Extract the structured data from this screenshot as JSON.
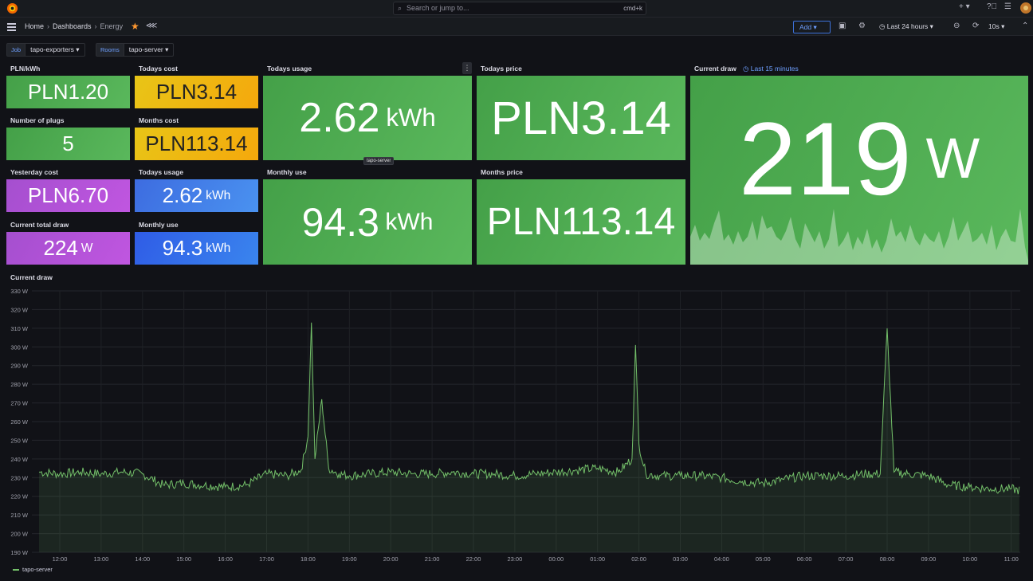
{
  "topbar": {
    "search_placeholder": "Search or jump to...",
    "search_shortcut": "cmd+k"
  },
  "breadcrumb": {
    "home": "Home",
    "dashboards": "Dashboards",
    "current": "Energy"
  },
  "toolbar": {
    "add_label": "Add",
    "time_range": "Last 24 hours",
    "refresh_interval": "10s"
  },
  "variables": [
    {
      "label": "Job",
      "value": "tapo-exporters"
    },
    {
      "label": "Rooms",
      "value": "tapo-server"
    }
  ],
  "panels": {
    "pln_kwh": {
      "title": "PLN/kWh",
      "value": "PLN1.20",
      "color": "#4ca64e"
    },
    "todays_cost": {
      "title": "Todays cost",
      "value": "PLN3.14",
      "color": "#f0b912"
    },
    "todays_usage_big": {
      "title": "Todays usage",
      "value": "2.62",
      "unit": "kWh",
      "color": "#4ca64e"
    },
    "todays_price": {
      "title": "Todays price",
      "value": "PLN3.14",
      "color": "#4ca64e"
    },
    "current_draw": {
      "title": "Current draw",
      "time_override": "Last 15 minutes",
      "value": "219",
      "unit": "W",
      "color": "#4ca64e"
    },
    "number_of_plugs": {
      "title": "Number of plugs",
      "value": "5",
      "color": "#4ca64e"
    },
    "months_cost": {
      "title": "Months cost",
      "value": "PLN113.14",
      "color": "#f0b912"
    },
    "yesterday_cost": {
      "title": "Yesterday cost",
      "value": "PLN6.70",
      "color": "#b052d8"
    },
    "todays_usage": {
      "title": "Todays usage",
      "value": "2.62",
      "unit": "kWh",
      "color": "#4282ea"
    },
    "monthly_use_big": {
      "title": "Monthly use",
      "value": "94.3",
      "unit": "kWh",
      "color": "#4ca64e"
    },
    "months_price": {
      "title": "Months price",
      "value": "PLN113.14",
      "color": "#4ca64e"
    },
    "current_total_draw": {
      "title": "Current total draw",
      "value": "224",
      "unit": "W",
      "color": "#b052d8"
    },
    "monthly_use": {
      "title": "Monthly use",
      "value": "94.3",
      "unit": "kWh",
      "color": "#3570e8"
    }
  },
  "tooltip_text": "tapo-server",
  "graph": {
    "title": "Current draw",
    "legend": "tapo-server"
  },
  "chart_data": {
    "type": "line",
    "title": "Current draw",
    "y_ticks": [
      "330 W",
      "320 W",
      "310 W",
      "300 W",
      "290 W",
      "280 W",
      "270 W",
      "260 W",
      "250 W",
      "240 W",
      "230 W",
      "220 W",
      "210 W",
      "200 W",
      "190 W"
    ],
    "ylim": [
      190,
      330
    ],
    "x_ticks": [
      "12:00",
      "13:00",
      "14:00",
      "15:00",
      "16:00",
      "17:00",
      "18:00",
      "19:00",
      "20:00",
      "21:00",
      "22:00",
      "23:00",
      "00:00",
      "01:00",
      "02:00",
      "03:00",
      "04:00",
      "05:00",
      "06:00",
      "07:00",
      "08:00",
      "09:00",
      "10:00",
      "11:00"
    ],
    "series": [
      {
        "name": "tapo-server",
        "color": "#73bf69",
        "x": [
          "11:30",
          "12:00",
          "12:30",
          "13:00",
          "13:30",
          "14:00",
          "14:30",
          "15:00",
          "15:30",
          "16:00",
          "16:30",
          "17:00",
          "17:30",
          "17:50",
          "18:00",
          "18:05",
          "18:10",
          "18:20",
          "18:30",
          "18:45",
          "19:00",
          "19:30",
          "20:00",
          "20:30",
          "21:00",
          "21:30",
          "22:00",
          "22:30",
          "23:00",
          "23:30",
          "00:00",
          "00:30",
          "01:00",
          "01:30",
          "01:50",
          "01:55",
          "02:00",
          "02:10",
          "02:30",
          "03:00",
          "03:30",
          "04:00",
          "04:30",
          "05:00",
          "05:30",
          "06:00",
          "06:30",
          "07:00",
          "07:30",
          "07:50",
          "08:00",
          "08:10",
          "08:30",
          "09:00",
          "09:30",
          "10:00",
          "10:30",
          "11:00",
          "11:15"
        ],
        "values": [
          233,
          232,
          233,
          232,
          233,
          232,
          226,
          227,
          226,
          225,
          226,
          232,
          231,
          234,
          252,
          313,
          240,
          272,
          235,
          232,
          231,
          232,
          233,
          232,
          232,
          233,
          232,
          232,
          231,
          232,
          233,
          234,
          235,
          233,
          240,
          301,
          248,
          232,
          231,
          231,
          231,
          230,
          228,
          227,
          229,
          231,
          231,
          231,
          232,
          232,
          310,
          233,
          232,
          231,
          226,
          225,
          224,
          224,
          223
        ]
      }
    ]
  }
}
